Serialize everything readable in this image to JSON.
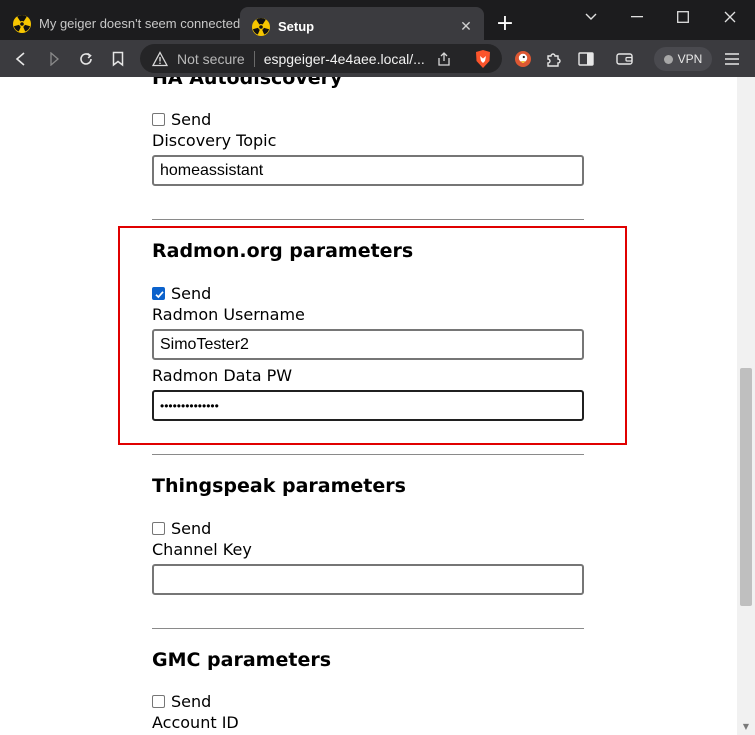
{
  "browser": {
    "tabs": [
      {
        "title": "My geiger doesn't seem connected - R",
        "active": false,
        "icon": "radiation-icon"
      },
      {
        "title": "Setup",
        "active": true,
        "icon": "radiation-icon"
      }
    ],
    "new_tab_label": "+",
    "address": {
      "security_label": "Not secure",
      "url": "espgeiger-4e4aee.local/..."
    },
    "vpn_label": "VPN",
    "accent": "#0b62cc",
    "highlight_color": "#e00000"
  },
  "page": {
    "sections": {
      "ha": {
        "title": "HA Autodiscovery",
        "send_label": "Send",
        "send_checked": false,
        "field_label": "Discovery Topic",
        "field_value": "homeassistant"
      },
      "radmon": {
        "title": "Radmon.org parameters",
        "send_label": "Send",
        "send_checked": true,
        "username_label": "Radmon Username",
        "username_value": "SimoTester2",
        "password_label": "Radmon Data PW",
        "password_mask": "••••••••••••••"
      },
      "thingspeak": {
        "title": "Thingspeak parameters",
        "send_label": "Send",
        "send_checked": false,
        "field_label": "Channel Key",
        "field_value": ""
      },
      "gmc": {
        "title": "GMC parameters",
        "send_label": "Send",
        "send_checked": false,
        "field_label": "Account ID"
      }
    }
  }
}
